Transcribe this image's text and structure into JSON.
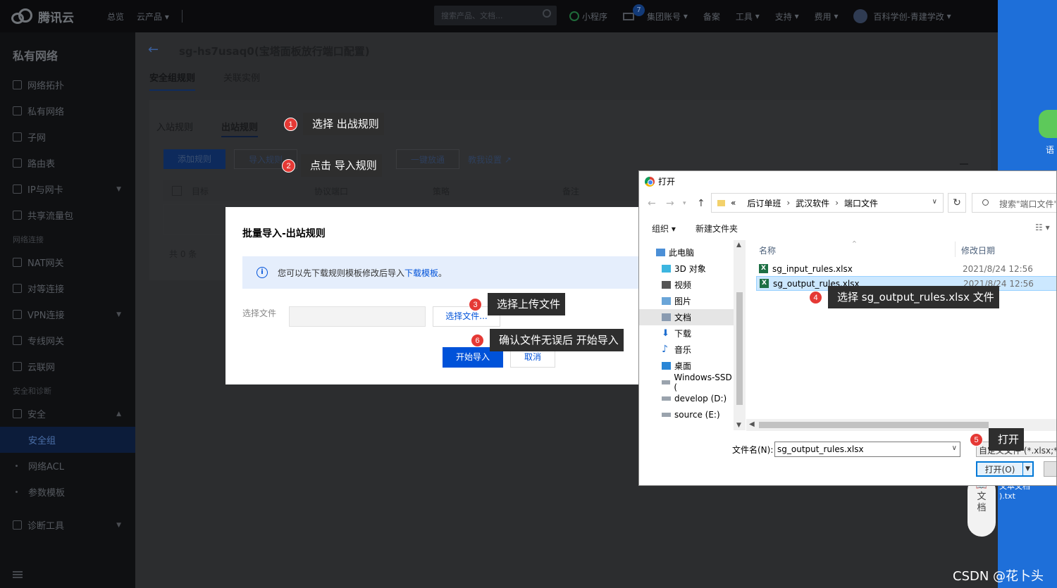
{
  "topbar": {
    "brand": "腾讯云",
    "nav": [
      "总览",
      "云产品"
    ],
    "search_placeholder": "搜索产品、文档...",
    "right": [
      "小程序",
      "集团账号",
      "备案",
      "工具",
      "支持",
      "费用",
      "百科学创-青建学改"
    ],
    "mail_badge": "7"
  },
  "sidebar": {
    "title": "私有网络",
    "items": [
      {
        "label": "网络拓扑"
      },
      {
        "label": "私有网络"
      },
      {
        "label": "子网"
      },
      {
        "label": "路由表"
      },
      {
        "label": "IP与网卡"
      },
      {
        "label": "共享流量包"
      }
    ],
    "group_network": "网络连接",
    "net_items": [
      {
        "label": "NAT网关"
      },
      {
        "label": "对等连接"
      },
      {
        "label": "VPN连接"
      },
      {
        "label": "专线网关"
      },
      {
        "label": "云联网"
      }
    ],
    "group_security": "安全和诊断",
    "security": "安全",
    "security_sub": [
      "安全组",
      "网络ACL",
      "参数模板"
    ],
    "diag": "诊断工具"
  },
  "main": {
    "title": "sg-hs7usaq0(宝塔面板放行端口配置)",
    "tabs": [
      "安全组规则",
      "关联实例"
    ],
    "subtabs": [
      "入站规则",
      "出站规则"
    ],
    "buttons": {
      "add": "添加规则",
      "import": "导入规则",
      "allow_all": "一键放通",
      "tutorial": "教我设置"
    },
    "columns": [
      "目标",
      "协议端口",
      "策略",
      "备注"
    ],
    "total": "共 0 条"
  },
  "modal": {
    "title": "批量导入-出站规则",
    "info_text": "您可以先下载规则模板修改后导入",
    "info_link": "下载模板",
    "info_end": "。",
    "file_label": "选择文件",
    "file_button": "选择文件...",
    "start_button": "开始导入",
    "cancel_button": "取消"
  },
  "callouts": [
    {
      "num": "1",
      "text": "选择 出战规则"
    },
    {
      "num": "2",
      "text": "点击 导入规则"
    },
    {
      "num": "3",
      "text": "选择上传文件"
    },
    {
      "num": "4",
      "text": "选择 sg_output_rules.xlsx 文件"
    },
    {
      "num": "5",
      "text": "打开"
    },
    {
      "num": "6",
      "text": "确认文件无误后 开始导入"
    }
  ],
  "dialog": {
    "title": "打开",
    "path": [
      "后订单班",
      "武汉软件",
      "端口文件"
    ],
    "path_prefix": "«",
    "search_placeholder": "搜索\"端口文件\"",
    "toolbar": {
      "organize": "组织 ▾",
      "new_folder": "新建文件夹"
    },
    "tree": [
      "此电脑",
      "3D 对象",
      "视频",
      "图片",
      "文档",
      "下载",
      "音乐",
      "桌面",
      "Windows-SSD (",
      "develop (D:)",
      "source (E:)"
    ],
    "columns": {
      "name": "名称",
      "date": "修改日期"
    },
    "files": [
      {
        "name": "sg_input_rules.xlsx",
        "date": "2021/8/24 12:56"
      },
      {
        "name": "sg_output_rules.xlsx",
        "date": "2021/8/24 12:56"
      }
    ],
    "filename_label": "文件名(N):",
    "filename_value": "sg_output_rules.xlsx",
    "filetype": "自定义文件 (*.xlsx;*.xls",
    "open_button": "打开(O)"
  },
  "desktop": {
    "icon_label": "语",
    "doc_float": "文档",
    "txt1": "文本文档",
    "txt2": ").txt",
    "watermark": "CSDN @花卜头"
  }
}
